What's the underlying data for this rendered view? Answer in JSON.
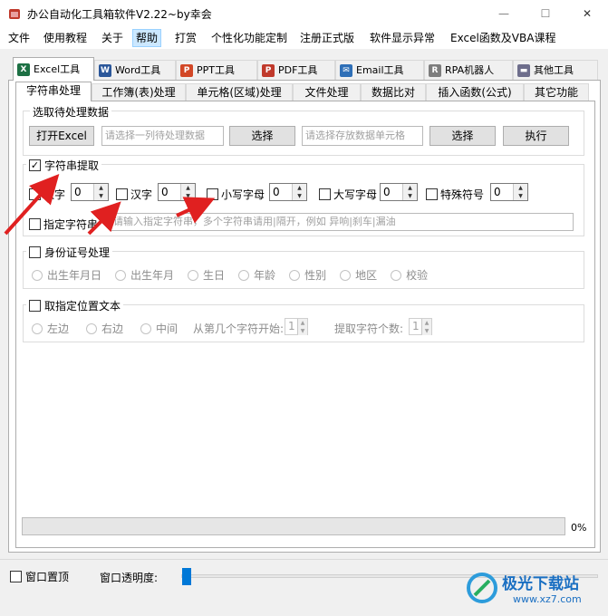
{
  "window": {
    "title": "办公自动化工具箱软件V2.22~by幸会",
    "minimize": "—",
    "maximize": "☐",
    "close": "✕"
  },
  "menu": [
    "文件",
    "使用教程",
    "关于",
    "帮助",
    "打赏",
    "个性化功能定制",
    "注册正式版",
    "软件显示异常",
    "Excel函数及VBA课程"
  ],
  "menu_active_index": 3,
  "main_tabs": [
    {
      "label": "Excel工具",
      "icon": "excel-icon",
      "color": "#1d7044",
      "glyph": "X"
    },
    {
      "label": "Word工具",
      "icon": "word-icon",
      "color": "#2b579a",
      "glyph": "W"
    },
    {
      "label": "PPT工具",
      "icon": "ppt-icon",
      "color": "#d24726",
      "glyph": "P"
    },
    {
      "label": "PDF工具",
      "icon": "pdf-icon",
      "color": "#c0392b",
      "glyph": "P"
    },
    {
      "label": "Email工具",
      "icon": "email-icon",
      "color": "#2e6fb7",
      "glyph": "✉"
    },
    {
      "label": "RPA机器人",
      "icon": "robot-icon",
      "color": "#7d7d7d",
      "glyph": "R"
    },
    {
      "label": "其他工具",
      "icon": "folder-icon",
      "color": "#6e6e8c",
      "glyph": "▬"
    }
  ],
  "sub_tabs": [
    "字符串处理",
    "工作簿(表)处理",
    "单元格(区域)处理",
    "文件处理",
    "数据比对",
    "插入函数(公式)",
    "其它功能"
  ],
  "select_data": {
    "legend": "选取待处理数据",
    "open_excel": "打开Excel",
    "source_placeholder": "请选择一列待处理数据",
    "select1": "选择",
    "target_placeholder": "请选择存放数据单元格",
    "select2": "选择",
    "execute": "执行"
  },
  "extract": {
    "legend": "字符串提取",
    "checked": true,
    "options": [
      {
        "label": "数字",
        "value": "0"
      },
      {
        "label": "汉字",
        "value": "0"
      },
      {
        "label": "小写字母",
        "value": "0"
      },
      {
        "label": "大写字母",
        "value": "0"
      },
      {
        "label": "特殊符号",
        "value": "0"
      }
    ],
    "specified_label": "指定字符串",
    "specified_placeholder": "请输入指定字符串，多个字符串请用|隔开，例如 异响|刹车|漏油"
  },
  "id_card": {
    "legend": "身份证号处理",
    "options": [
      "出生年月日",
      "出生年月",
      "生日",
      "年龄",
      "性别",
      "地区",
      "校验"
    ]
  },
  "position": {
    "legend": "取指定位置文本",
    "options": [
      "左边",
      "右边",
      "中间"
    ],
    "start_label": "从第几个字符开始:",
    "start_value": "1",
    "count_label": "提取字符个数:",
    "count_value": "1"
  },
  "progress": {
    "percent_label": "0%",
    "fraction": 0
  },
  "bottom": {
    "pin_label": "窗口置顶",
    "opacity_label": "窗口透明度:",
    "opacity_fraction": 0
  },
  "watermark": {
    "brand": "极光下载站",
    "url": "www.xz7.com"
  },
  "colors": {
    "accent": "#0078d7",
    "arrow": "#e02020",
    "selection": "#cce8ff"
  }
}
